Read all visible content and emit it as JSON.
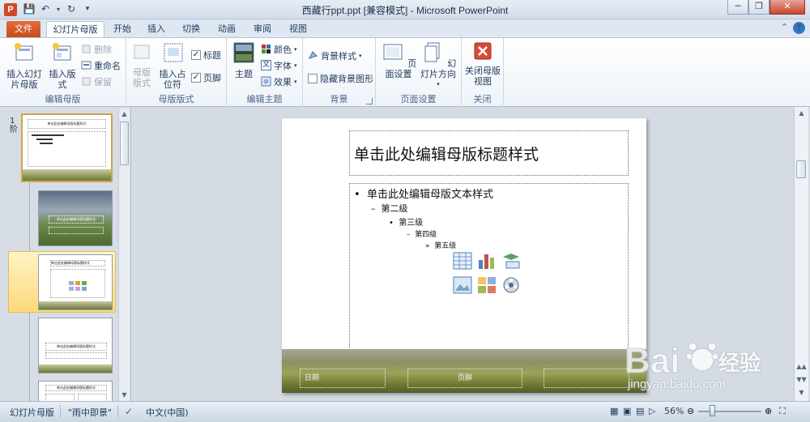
{
  "titlebar": {
    "title": "西藏行ppt.ppt [兼容模式] - Microsoft PowerPoint",
    "app_icon_letter": "P"
  },
  "tabs": {
    "file": "文件",
    "items": [
      "幻灯片母版",
      "开始",
      "插入",
      "切换",
      "动画",
      "审阅",
      "视图"
    ]
  },
  "ribbon": {
    "groups": {
      "edit_master": {
        "label": "编辑母版",
        "insert_slide_master": "插入幻灯片母版",
        "insert_layout": "插入版式",
        "delete": "删除",
        "rename": "重命名",
        "preserve": "保留"
      },
      "master_layout": {
        "label": "母版版式",
        "master_layout_btn": "母版版式",
        "insert_placeholder": "插入占位符",
        "title_chk": "标题",
        "footer_chk": "页脚"
      },
      "edit_theme": {
        "label": "编辑主题",
        "themes": "主题",
        "colors": "颜色",
        "fonts": "字体",
        "effects": "效果"
      },
      "background": {
        "label": "背景",
        "background_styles": "背景样式",
        "hide_bg_graphics": "隐藏背景图形"
      },
      "page_setup": {
        "label": "页面设置",
        "page_setup_btn": "页面设置",
        "slide_orientation": "幻灯片方向"
      },
      "close": {
        "label": "关闭",
        "close_master_view": "关闭母版视图"
      }
    }
  },
  "thumbnails": {
    "first_number": "1",
    "first_label": "阶",
    "mini_title": "单击此处编辑母版标题样式"
  },
  "slide": {
    "title_placeholder": "单击此处编辑母版标题样式",
    "levels": [
      "单击此处编辑母版文本样式",
      "第二级",
      "第三级",
      "第四级",
      "第五级"
    ],
    "footer_date": "日期",
    "footer_center": "页脚"
  },
  "statusbar": {
    "view": "幻灯片母版",
    "theme": "\"雨中即景\"",
    "language": "中文(中国)",
    "zoom": "56%"
  },
  "watermark": {
    "brand": "Baidu经验",
    "url": "jingyan.baidu.com"
  },
  "colors": {
    "file_tab": "#d24726",
    "accent": "#1e395b",
    "selection": "#ffd97a"
  }
}
